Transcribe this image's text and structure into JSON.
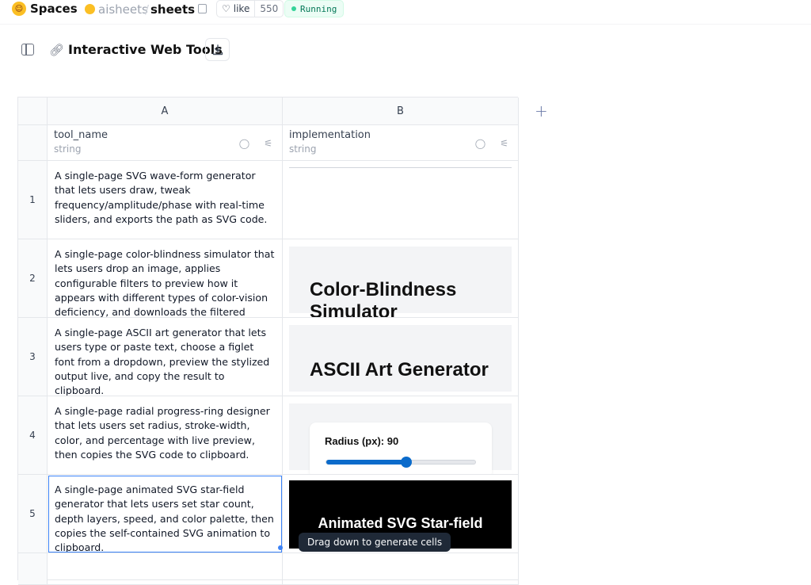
{
  "hf": {
    "spaces_label": "Spaces",
    "owner": "aisheets",
    "slash": "/",
    "repo": "sheets",
    "like_label": "like",
    "like_count": "550",
    "status": "Running"
  },
  "toolbar": {
    "title": "Interactive Web Tools"
  },
  "columns": [
    {
      "letter": "A",
      "name": "tool_name",
      "type": "string"
    },
    {
      "letter": "B",
      "name": "implementation",
      "type": "string"
    }
  ],
  "rows": [
    {
      "num": "1",
      "tool_name": "A single-page SVG wave-form generator that lets users draw, tweak frequency/amplitude/phase with real-time sliders, and exports the path as SVG code."
    },
    {
      "num": "2",
      "tool_name": "A single-page color-blindness simulator that lets users drop an image, applies configurable filters to preview how it appears with different types of color-vision deficiency, and downloads the filtered image.",
      "preview_title": "Color-Blindness Simulator"
    },
    {
      "num": "3",
      "tool_name": "A single-page ASCII art generator that lets users type or paste text, choose a figlet font from a dropdown, preview the stylized output live, and copy the result to clipboard.",
      "preview_title": "ASCII Art Generator"
    },
    {
      "num": "4",
      "tool_name": "A single-page radial progress-ring designer that lets users set radius, stroke-width, color, and percentage with live preview, then copies the SVG code to clipboard.",
      "preview_label": "Radius (px): 90",
      "slider_fraction": 0.53
    },
    {
      "num": "5",
      "tool_name": "A single-page animated SVG star-field generator that lets users set star count, depth layers, speed, and color palette, then copies the self-contained SVG animation to clipboard.",
      "preview_title": "Animated SVG Star-field"
    }
  ],
  "tooltip": "Drag down to generate cells",
  "colors": {
    "accent": "#3b82f6",
    "running": "#047857",
    "slider": "#0b6bcb"
  }
}
